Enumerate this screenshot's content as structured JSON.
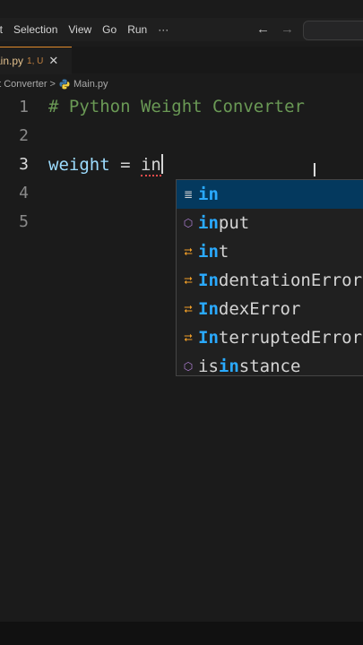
{
  "menubar": {
    "items": [
      "it",
      "Selection",
      "View",
      "Go",
      "Run",
      "···"
    ],
    "nav_back": "←",
    "nav_forward": "→"
  },
  "tab": {
    "name": "ain.py",
    "status": "1, U",
    "close": "✕"
  },
  "breadcrumb": {
    "folder": "ht Converter",
    "separator": ">",
    "file": "Main.py"
  },
  "editor": {
    "lines": [
      {
        "num": "1",
        "comment": "# Python Weight Converter"
      },
      {
        "num": "2"
      },
      {
        "num": "3",
        "var": "weight",
        "op": " = ",
        "typed": "in"
      },
      {
        "num": "4"
      },
      {
        "num": "5"
      }
    ]
  },
  "suggestions": [
    {
      "icon": "keyword-icon",
      "glyph": "≣",
      "match": "in",
      "rest": ""
    },
    {
      "icon": "function-icon",
      "glyph": "⬡",
      "match": "in",
      "rest": "put"
    },
    {
      "icon": "class-icon",
      "glyph": "⮂",
      "match": "in",
      "rest": "t"
    },
    {
      "icon": "class-icon",
      "glyph": "⮂",
      "match": "In",
      "rest": "dentationError"
    },
    {
      "icon": "class-icon",
      "glyph": "⮂",
      "match": "In",
      "rest": "dexError"
    },
    {
      "icon": "class-icon",
      "glyph": "⮂",
      "match": "In",
      "rest": "terruptedError"
    },
    {
      "icon": "function-icon",
      "glyph": "⬡",
      "pre": "is",
      "match": "in",
      "rest": "stance"
    }
  ],
  "ibeam": "I",
  "colors": {
    "background": "#1b1b1b",
    "comment": "#6a9955",
    "variable": "#9cdcfe",
    "suggestion_highlight": "#2aaaff",
    "selected_row": "#04395e",
    "tab_accent": "#e08a2a"
  }
}
